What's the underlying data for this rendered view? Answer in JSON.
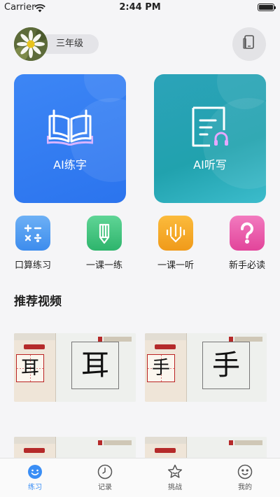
{
  "status_bar": {
    "carrier": "Carrier",
    "time": "2:44 PM",
    "battery_level": 1.0
  },
  "profile": {
    "grade": "三年级",
    "avatar_icon": "daisy-photo"
  },
  "header_right_icon": "tablet-icon",
  "cards": {
    "practice": {
      "label": "AI练字",
      "icon": "book-icon"
    },
    "dictation": {
      "label": "AI听写",
      "icon": "document-headphones-icon"
    }
  },
  "quick_actions": [
    {
      "label": "口算练习",
      "icon": "calculator-icon",
      "color": "#4f9bf0"
    },
    {
      "label": "一课一练",
      "icon": "pencil-icon",
      "color": "#37c07a"
    },
    {
      "label": "一课一听",
      "icon": "soundwave-download-icon",
      "color": "#f5a524"
    },
    {
      "label": "新手必读",
      "icon": "question-icon",
      "color": "#ec4fa2"
    }
  ],
  "section": {
    "title": "推荐视频"
  },
  "videos": [
    {
      "char": "耳"
    },
    {
      "char": "手"
    }
  ],
  "tabs": [
    {
      "label": "练习",
      "icon": "smile-icon",
      "active": true
    },
    {
      "label": "记录",
      "icon": "clock-icon",
      "active": false
    },
    {
      "label": "挑战",
      "icon": "star-icon",
      "active": false
    },
    {
      "label": "我的",
      "icon": "face-icon",
      "active": false
    }
  ],
  "colors": {
    "accent": "#3a8ef5",
    "practice_card": "#3180f2",
    "dictation_card": "#27a6b5"
  }
}
